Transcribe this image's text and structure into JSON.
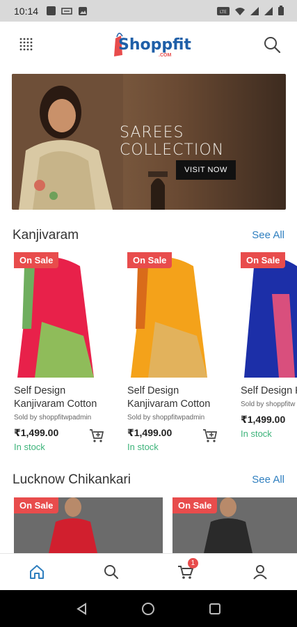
{
  "status_bar": {
    "time": "10:14"
  },
  "header": {
    "logo_text": "Shoppfit",
    "logo_sub": ".COM"
  },
  "banner": {
    "title": "SAREES COLLECTION",
    "button": "VISIT NOW"
  },
  "sections": [
    {
      "title": "Kanjivaram",
      "see_all": "See All",
      "products": [
        {
          "badge": "On Sale",
          "name": "Self Design Kanjivaram Cotton",
          "seller": "Sold by shoppfitwpadmin",
          "price": "₹1,499.00",
          "stock": "In stock",
          "colors": [
            "#e8214a",
            "#6fae5e"
          ]
        },
        {
          "badge": "On Sale",
          "name": "Self Design Kanjivaram Cotton",
          "seller": "Sold by shoppfitwpadmin",
          "price": "₹1,499.00",
          "stock": "In stock",
          "colors": [
            "#f4a21a",
            "#d96b1a"
          ]
        },
        {
          "badge": "On Sale",
          "name": "Self Design Kanjivaram",
          "seller": "Sold by shoppfitw",
          "price": "₹1,499.00",
          "stock": "In stock",
          "colors": [
            "#1c2fa8",
            "#d94f7d"
          ]
        }
      ]
    },
    {
      "title": "Lucknow Chikankari",
      "see_all": "See All",
      "products": [
        {
          "badge": "On Sale",
          "colors": [
            "#6b6b6b",
            "#d11f2e"
          ]
        },
        {
          "badge": "On Sale",
          "colors": [
            "#6b6b6b",
            "#2a2a2a"
          ]
        }
      ]
    }
  ],
  "bottom_nav": {
    "cart_count": "1",
    "accent": "#2f7fbf"
  }
}
